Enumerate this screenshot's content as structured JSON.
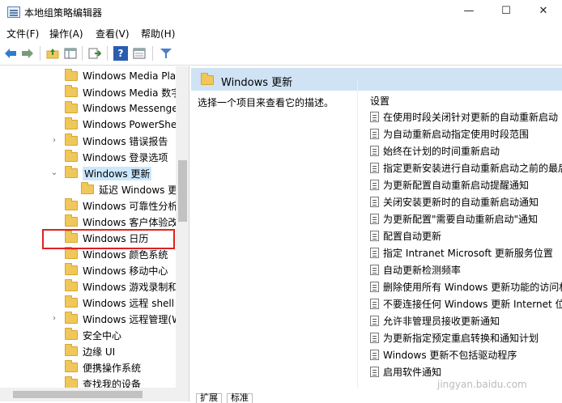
{
  "window": {
    "title": "本地组策略编辑器",
    "minimize": "—",
    "maximize": "☐",
    "close": "✕"
  },
  "menu": [
    "文件(F)",
    "操作(A)",
    "查看(V)",
    "帮助(H)"
  ],
  "toolbar": {
    "icons": [
      "back-icon",
      "forward-icon",
      "up-folder-icon",
      "show-hide-tree-icon",
      "export-list-icon",
      "help-icon",
      "extended-view-icon",
      "filter-icon"
    ],
    "help_glyph": "?"
  },
  "tree": {
    "items": [
      {
        "label": "Windows Media Player",
        "arrow": ""
      },
      {
        "label": "Windows Media 数字权限管理",
        "arrow": ""
      },
      {
        "label": "Windows Messenger",
        "arrow": ""
      },
      {
        "label": "Windows PowerShell",
        "arrow": ""
      },
      {
        "label": "Windows 错误报告",
        "arrow": "›"
      },
      {
        "label": "Windows 登录选项",
        "arrow": ""
      },
      {
        "label": "Windows 更新",
        "arrow": "⌄"
      },
      {
        "label": "延迟 Windows 更新",
        "arrow": ""
      },
      {
        "label": "Windows 可靠性分析",
        "arrow": ""
      },
      {
        "label": "Windows 客户体验改善计划",
        "arrow": ""
      },
      {
        "label": "Windows 日历",
        "arrow": ""
      },
      {
        "label": "Windows 颜色系统",
        "arrow": ""
      },
      {
        "label": "Windows 移动中心",
        "arrow": ""
      },
      {
        "label": "Windows 游戏录制和广播",
        "arrow": ""
      },
      {
        "label": "Windows 远程 shell",
        "arrow": ""
      },
      {
        "label": "Windows 远程管理(WinRM)",
        "arrow": "›"
      },
      {
        "label": "安全中心",
        "arrow": ""
      },
      {
        "label": "边缘 UI",
        "arrow": ""
      },
      {
        "label": "便携操作系统",
        "arrow": ""
      },
      {
        "label": "查找我的设备",
        "arrow": ""
      }
    ]
  },
  "details": {
    "header": "Windows 更新",
    "description": "选择一个项目来查看它的描述。",
    "column_header": "设置",
    "settings": [
      "在使用时段关闭针对更新的自动重新启动",
      "为自动重新启动指定使用时段范围",
      "始终在计划的时间重新启动",
      "指定更新安装进行自动重新启动之前的最后期限",
      "为更新配置自动重新启动提醒通知",
      "关闭安装更新时的自动重新启动通知",
      "为更新配置\"需要自动重新启动\"通知",
      "配置自动更新",
      "指定 Intranet Microsoft 更新服务位置",
      "自动更新检测频率",
      "删除使用所有 Windows 更新功能的访问权限",
      "不要连接任何 Windows 更新 Internet 位置",
      "允许非管理员接收更新通知",
      "为更新指定预定重启转换和通知计划",
      "Windows 更新不包括驱动程序",
      "启用软件通知"
    ],
    "tabs": [
      "扩展",
      "标准"
    ]
  },
  "watermark": "jingyan.baidu.com"
}
